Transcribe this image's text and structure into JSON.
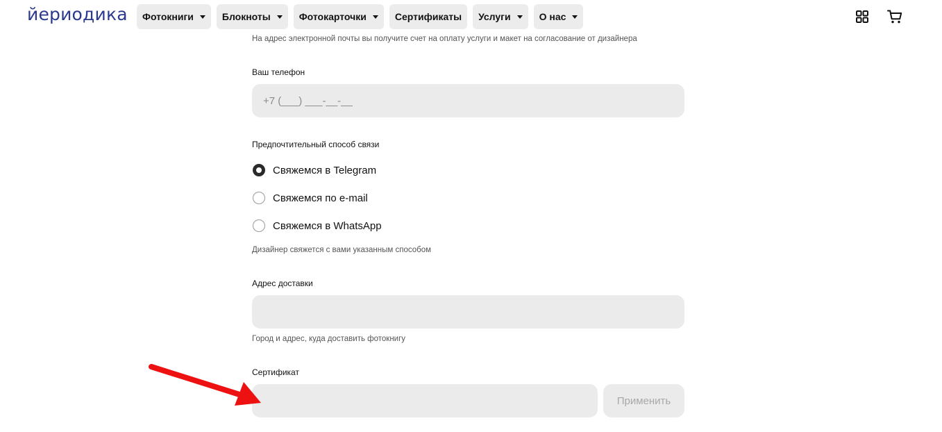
{
  "brand": {
    "logo_text": "йериодика",
    "logo_color": "#2b3a8f"
  },
  "nav": {
    "items": [
      {
        "label": "Фотокниги",
        "has_dropdown": true
      },
      {
        "label": "Блокноты",
        "has_dropdown": true
      },
      {
        "label": "Фотокарточки",
        "has_dropdown": true
      },
      {
        "label": "Сертификаты",
        "has_dropdown": false
      },
      {
        "label": "Услуги",
        "has_dropdown": true
      },
      {
        "label": "О нас",
        "has_dropdown": true
      }
    ],
    "icons": [
      "grid-icon",
      "cart-icon"
    ]
  },
  "form": {
    "email_hint": "На адрес электронной почты вы получите счет на оплату услуги и макет на согласование от дизайнера",
    "phone": {
      "label": "Ваш телефон",
      "placeholder": "+7 (___) ___-__-__",
      "value": ""
    },
    "contact_method": {
      "label": "Предпочтительный способ связи",
      "options": [
        {
          "label": "Свяжемся в Telegram",
          "checked": true
        },
        {
          "label": "Свяжемся по e-mail",
          "checked": false
        },
        {
          "label": "Свяжемся в WhatsApp",
          "checked": false
        }
      ],
      "hint": "Дизайнер свяжется с вами указанным способом"
    },
    "address": {
      "label": "Адрес доставки",
      "value": "",
      "hint": "Город и адрес, куда доставить фотокнигу"
    },
    "certificate": {
      "label": "Сертификат",
      "value": "",
      "apply_label": "Применить"
    }
  },
  "annotation": {
    "type": "arrow",
    "color": "#ee1111",
    "points_to": "certificate-input"
  }
}
